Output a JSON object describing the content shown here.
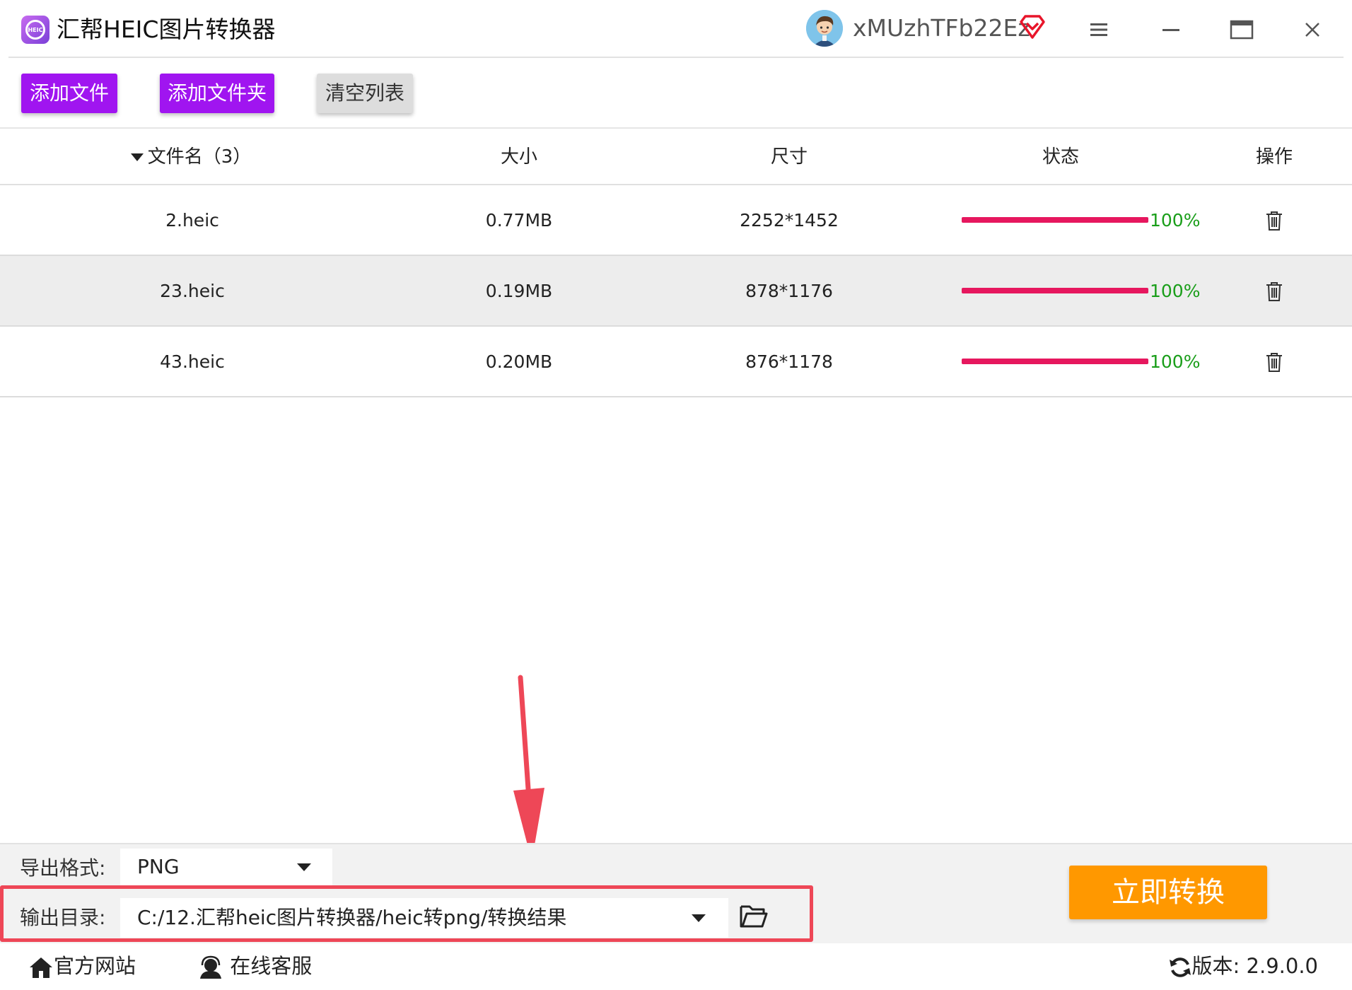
{
  "app": {
    "title": "汇帮HEIC图片转换器",
    "logo_text": "HEIC"
  },
  "user": {
    "name": "xMUzhTFb22Ez"
  },
  "toolbar": {
    "add_file": "添加文件",
    "add_folder": "添加文件夹",
    "clear_list": "清空列表"
  },
  "table": {
    "columns": {
      "filename": "文件名（3）",
      "size": "大小",
      "dimensions": "尺寸",
      "status": "状态",
      "action": "操作"
    },
    "rows": [
      {
        "name": "2.heic",
        "size": "0.77MB",
        "dimensions": "2252*1452",
        "progress": 100,
        "status_text": "100%"
      },
      {
        "name": "23.heic",
        "size": "0.19MB",
        "dimensions": "878*1176",
        "progress": 100,
        "status_text": "100%"
      },
      {
        "name": "43.heic",
        "size": "0.20MB",
        "dimensions": "876*1178",
        "progress": 100,
        "status_text": "100%"
      }
    ]
  },
  "export": {
    "format_label": "导出格式:",
    "format_value": "PNG",
    "dir_label": "输出目录:",
    "dir_value": "C:/12.汇帮heic图片转换器/heic转png/转换结果"
  },
  "convert_button": "立即转换",
  "footer": {
    "website": "官方网站",
    "support": "在线客服",
    "version": "版本: 2.9.0.0"
  },
  "colors": {
    "accent_purple": "#a015f0",
    "progress": "#e6175e",
    "status_green": "#1a9e1a",
    "convert": "#ff9800",
    "annotation_red": "#ee4757"
  }
}
